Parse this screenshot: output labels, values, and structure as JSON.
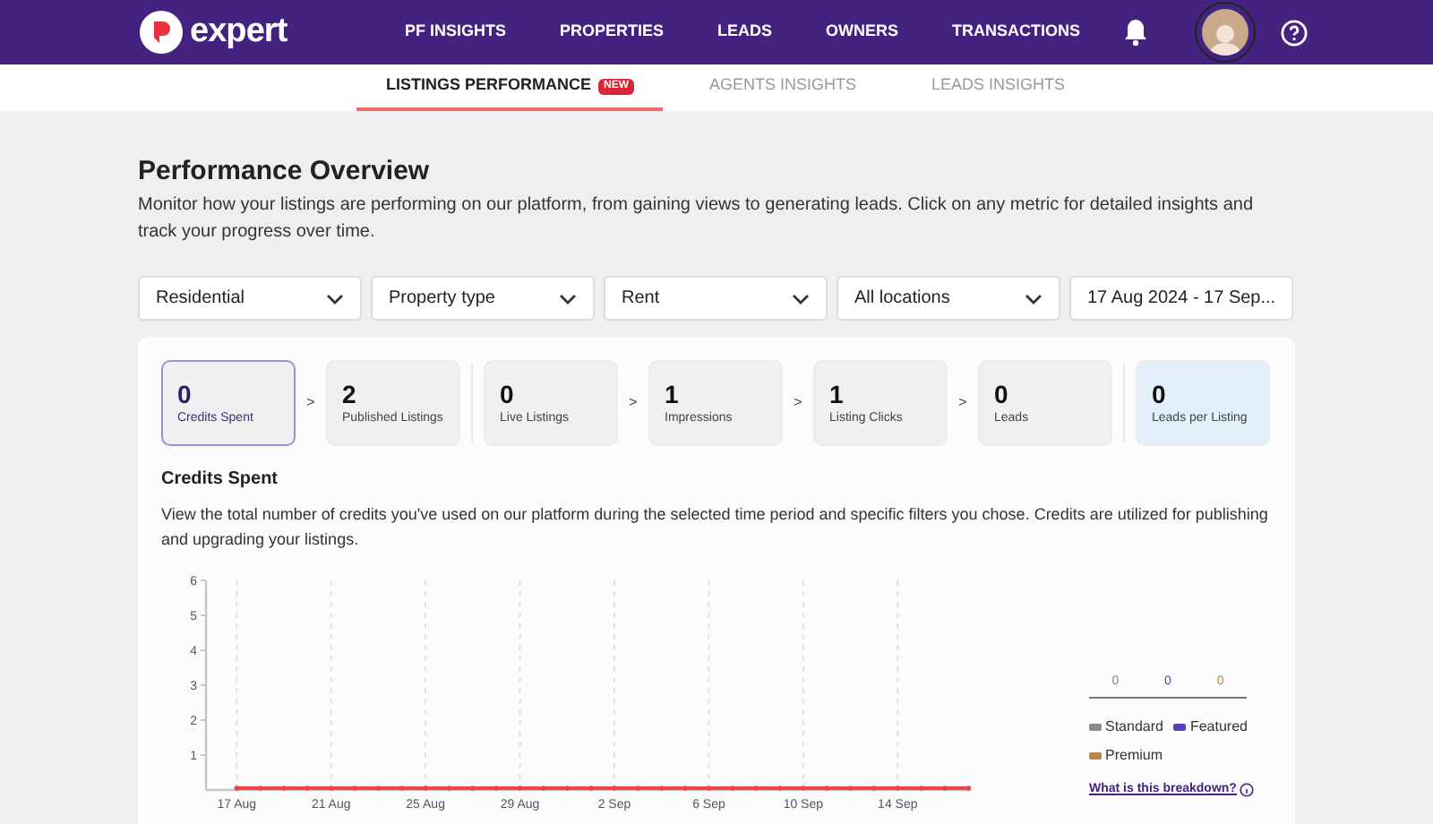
{
  "header": {
    "logo_text": "expert",
    "nav": [
      "PF INSIGHTS",
      "PROPERTIES",
      "LEADS",
      "OWNERS",
      "TRANSACTIONS"
    ]
  },
  "tabs": [
    {
      "label": "LISTINGS PERFORMANCE",
      "badge": "NEW",
      "selected": true
    },
    {
      "label": "AGENTS INSIGHTS",
      "selected": false
    },
    {
      "label": "LEADS INSIGHTS",
      "selected": false
    }
  ],
  "page": {
    "title": "Performance Overview",
    "description": "Monitor how your listings are performing on our platform, from gaining views to generating leads. Click on any metric for detailed insights and track your progress over time."
  },
  "filters": [
    "Residential",
    "Property type",
    "Rent",
    "All locations",
    "17 Aug 2024 - 17 Sep..."
  ],
  "metrics": [
    {
      "value": "0",
      "label": "Credits Spent",
      "selected": true,
      "highlighted": false
    },
    {
      "value": "2",
      "label": "Published Listings",
      "arrow": ">",
      "selected": false,
      "highlighted": false
    },
    {
      "value": "0",
      "label": "Live Listings",
      "selected": false,
      "highlighted": false
    },
    {
      "value": "1",
      "label": "Impressions",
      "arrow": ">",
      "selected": false,
      "highlighted": false
    },
    {
      "value": "1",
      "label": "Listing Clicks",
      "arrow": ">",
      "selected": false,
      "highlighted": false
    },
    {
      "value": "0",
      "label": "Leads",
      "arrow": ">",
      "selected": false,
      "highlighted": false
    },
    {
      "value": "0",
      "label": "Leads per Listing",
      "selected": false,
      "highlighted": true
    }
  ],
  "detail": {
    "title": "Credits Spent",
    "description": "View the total number of credits you've used on our platform during the selected time period and specific filters you chose. Credits are utilized for publishing and upgrading your listings.",
    "chart_data": {
      "type": "line",
      "categories": [
        "17 Aug",
        null,
        null,
        null,
        "21 Aug",
        null,
        null,
        null,
        "25 Aug",
        null,
        null,
        null,
        "29 Aug",
        null,
        null,
        null,
        "2 Sep",
        null,
        null,
        null,
        "6 Sep",
        null,
        null,
        null,
        "10 Sep",
        null,
        null,
        null,
        "14 Sep",
        null,
        null,
        null
      ],
      "grid": true,
      "ylim": [
        0,
        6
      ],
      "yticks": [
        1,
        2,
        3,
        4,
        5,
        6
      ],
      "series": [
        {
          "color": "#ef4444",
          "values": [
            0,
            0,
            0,
            0,
            0,
            0,
            0,
            0,
            0,
            0,
            0,
            0,
            0,
            0,
            0,
            0,
            0,
            0,
            0,
            0,
            0,
            0,
            0,
            0,
            0,
            0,
            0,
            0,
            0,
            0,
            0,
            0
          ]
        }
      ]
    },
    "breakdown": {
      "values": [
        {
          "value": "0",
          "color": "#8a8a8a"
        },
        {
          "value": "0",
          "color": "#5b3fb8"
        },
        {
          "value": "0",
          "color": "#b8874f"
        }
      ],
      "legend": [
        {
          "label": "Standard",
          "color": "#8a8a8a"
        },
        {
          "label": "Featured",
          "color": "#5b3fb8"
        },
        {
          "label": "Premium",
          "color": "#b8874f"
        }
      ],
      "link": "What is this breakdown?"
    }
  }
}
